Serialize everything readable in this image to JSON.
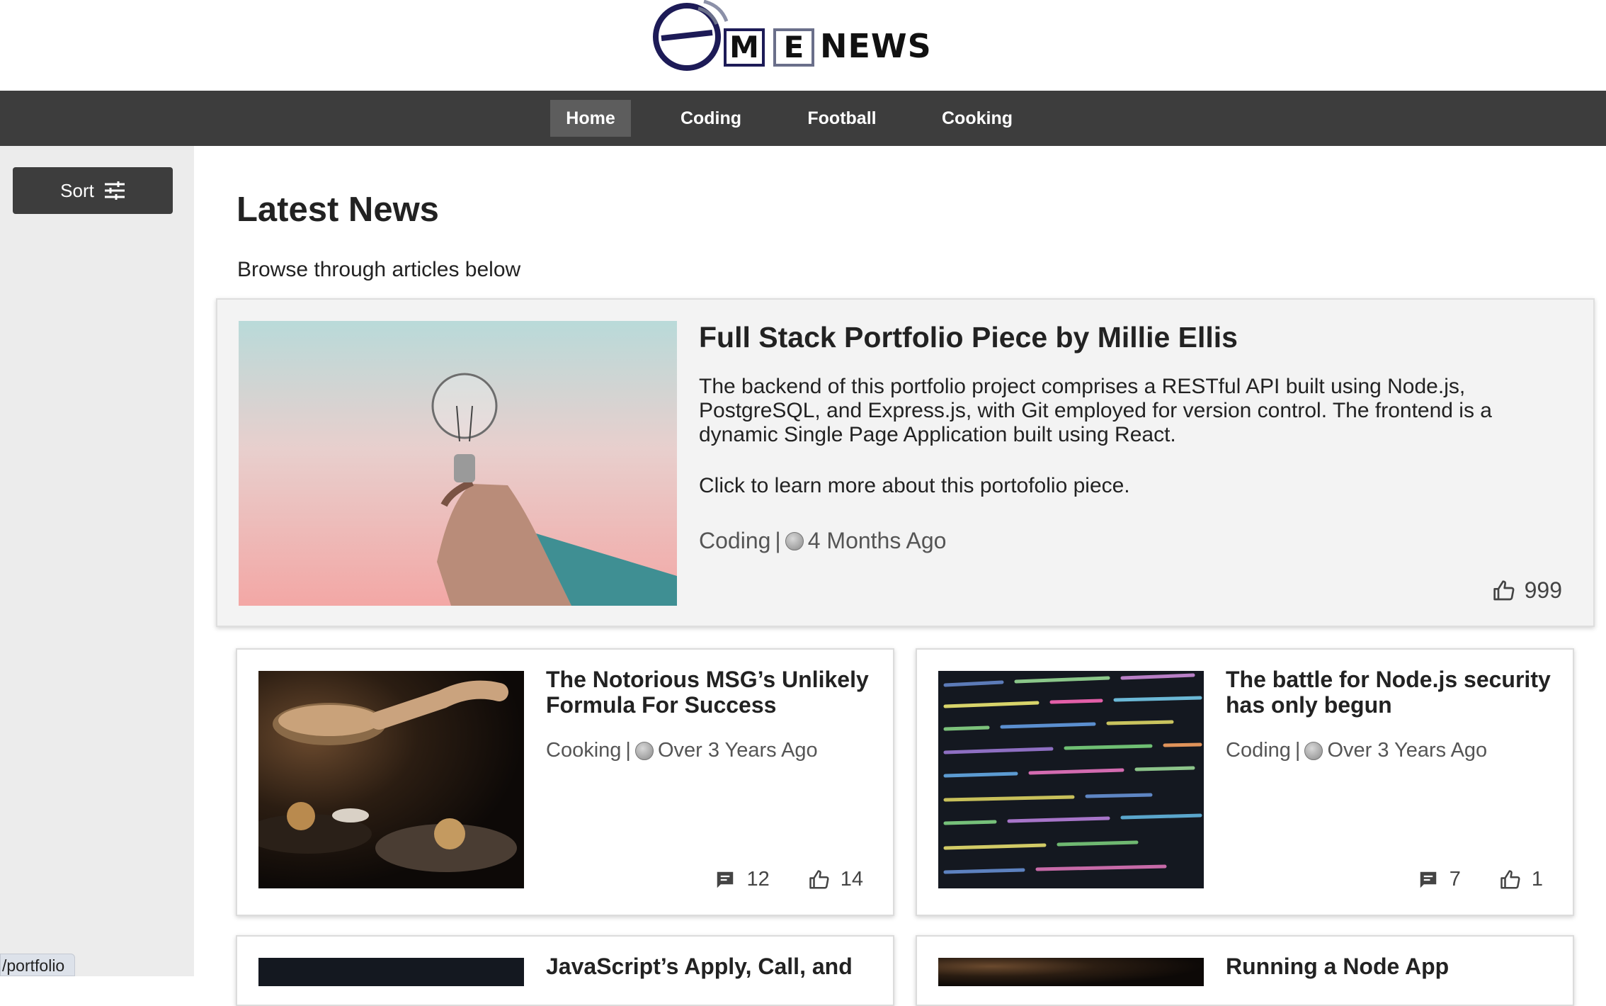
{
  "header": {
    "logo_m": "M",
    "logo_e": "E",
    "logo_word": "NEWS"
  },
  "nav": {
    "items": [
      {
        "label": "Home",
        "active": true
      },
      {
        "label": "Coding",
        "active": false
      },
      {
        "label": "Football",
        "active": false
      },
      {
        "label": "Cooking",
        "active": false
      }
    ]
  },
  "sidebar": {
    "sort_label": "Sort",
    "sort_icon": "sliders-icon"
  },
  "status_url": "/portfolio",
  "main": {
    "title": "Latest News",
    "subtitle": "Browse through articles below"
  },
  "featured": {
    "title": "Full Stack Portfolio Piece by Millie Ellis",
    "body": "The backend of this portfolio project comprises a RESTful API built using Node.js, PostgreSQL, and Express.js, with Git employed for version control. The frontend is a dynamic Single Page Application built using React.",
    "cta": "Click to learn more about this portofolio piece.",
    "topic": "Coding",
    "separator": "|",
    "age": "4 Months Ago",
    "likes": "999"
  },
  "articles": [
    {
      "title": "The Notorious MSG’s Unlikely Formula For Success",
      "topic": "Cooking",
      "separator": "|",
      "age": "Over 3 Years Ago",
      "comments": "12",
      "likes": "14"
    },
    {
      "title": "The battle for Node.js security has only begun",
      "topic": "Coding",
      "separator": "|",
      "age": "Over 3 Years Ago",
      "comments": "7",
      "likes": "1"
    },
    {
      "title": "JavaScript’s Apply, Call, and"
    },
    {
      "title": "Running a Node App"
    }
  ],
  "colors": {
    "nav_bg": "#3d3d3d",
    "nav_active": "#5d5d5d",
    "sidebar_bg": "#ececec",
    "logo_navy": "#1d1b57"
  }
}
